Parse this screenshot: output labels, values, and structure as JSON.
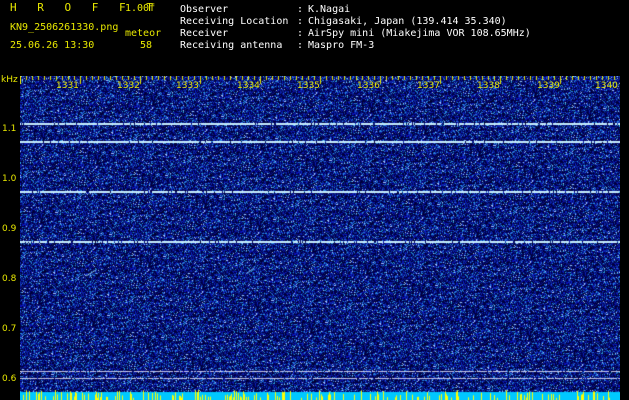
{
  "header": {
    "title": "H R O F F T",
    "version": "1.00f",
    "filename": "KN9_2506261330.png",
    "meteor_label": "meteor",
    "datetime": "25.06.26 13:30",
    "meteor_count": "58",
    "info": [
      {
        "label": "Observer",
        "sep": ":",
        "value": "K.Nagai"
      },
      {
        "label": "Receiving Location",
        "sep": ":",
        "value": "Chigasaki, Japan (139.414 35.340)"
      },
      {
        "label": "Receiver",
        "sep": ":",
        "value": "AirSpy mini (Miakejima VOR 108.65MHz)"
      },
      {
        "label": "Receiving antenna",
        "sep": ":",
        "value": "Maspro FM-3"
      }
    ]
  },
  "spectrogram": {
    "y_unit": "kHz",
    "y_ticks": [
      "1.1",
      "1.0",
      "0.9",
      "0.8",
      "0.7",
      "0.6"
    ],
    "x_ticks": [
      "1331",
      "1332",
      "1333",
      "1334",
      "1335",
      "1336",
      "1337",
      "1338",
      "1339",
      "1340"
    ],
    "colors": {
      "background": "#000000",
      "noise_base": "#0a0a6e",
      "trace": "#c8f0ff",
      "tick": "#e8e800",
      "bottom_band": "#00c8ff"
    },
    "carrier_khz": [
      1.11,
      1.075,
      0.975,
      0.875,
      0.615,
      0.6
    ]
  }
}
